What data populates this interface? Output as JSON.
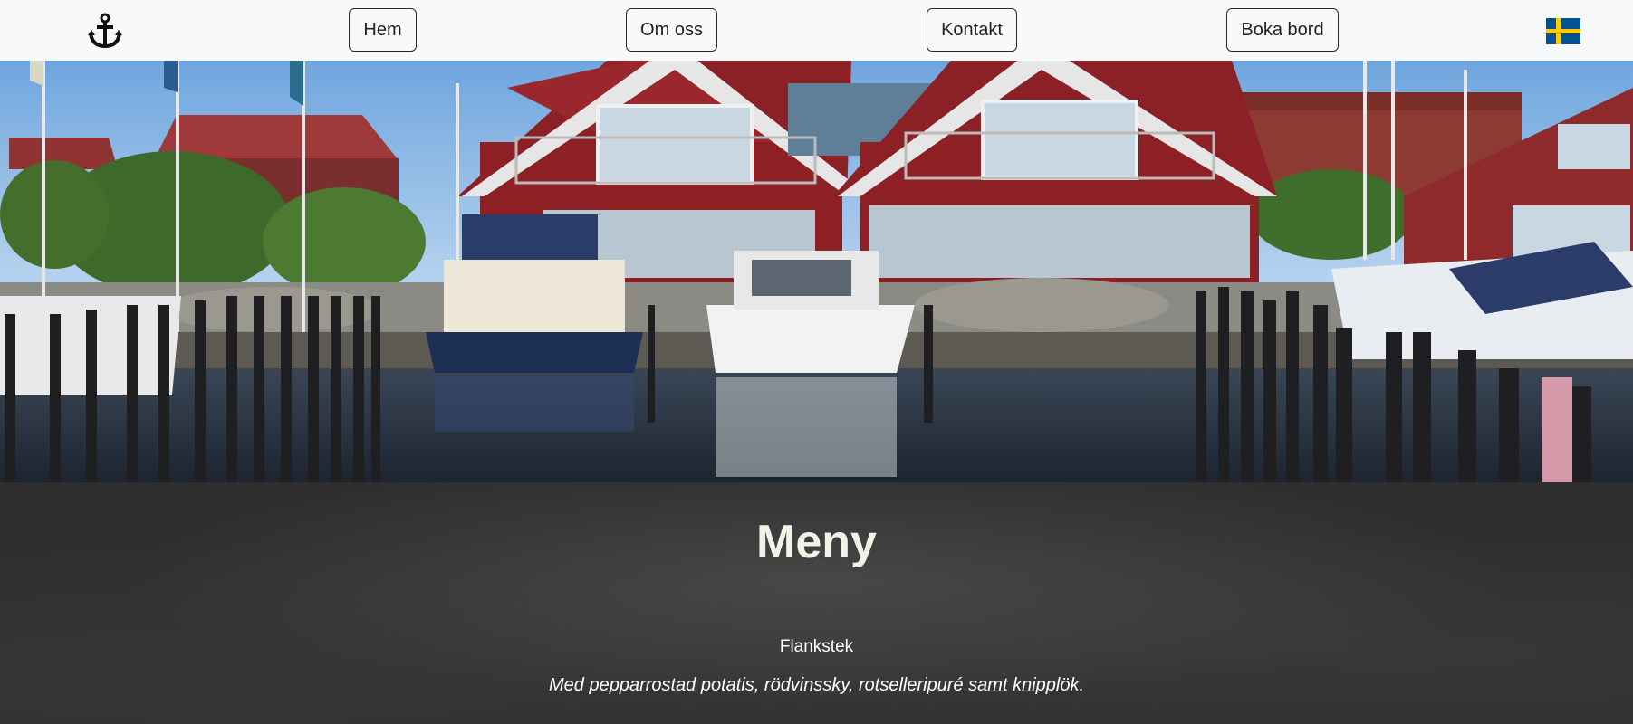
{
  "nav": {
    "logo_icon": "anchor-icon",
    "items": [
      {
        "label": "Hem"
      },
      {
        "label": "Om oss"
      },
      {
        "label": "Kontakt"
      },
      {
        "label": "Boka bord"
      }
    ],
    "language_icon": "swedish-flag-icon"
  },
  "hero": {
    "image_description_icon": "harbor-photo"
  },
  "menu": {
    "title": "Meny",
    "dishes": [
      {
        "name": "Flankstek",
        "description": "Med pepparrostad potatis, rödvinssky, rotselleripuré samt knipplök."
      }
    ]
  },
  "colors": {
    "navbar_bg": "#f8f9fa",
    "menu_bg": "#2e2e2e",
    "title_color": "#eef5e6",
    "flag_blue": "#005293",
    "flag_yellow": "#fecb00"
  }
}
